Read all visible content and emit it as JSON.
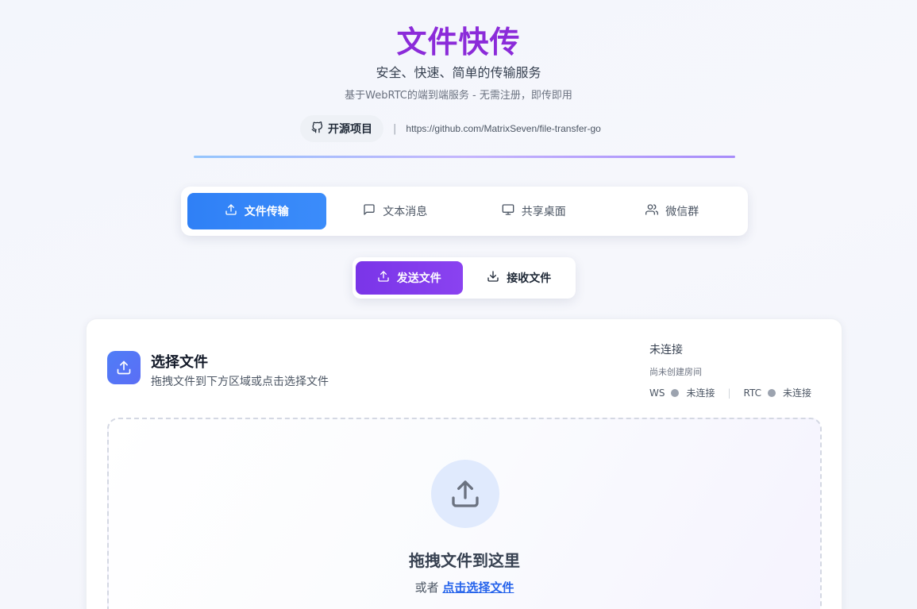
{
  "header": {
    "title": "文件快传",
    "subtitle": "安全、快速、简单的传输服务",
    "tagline": "基于WebRTC的端到端服务 - 无需注册，即传即用",
    "repo_label": "开源项目",
    "repo_separator": "|",
    "repo_url": "https://github.com/MatrixSeven/file-transfer-go"
  },
  "main_tabs": [
    {
      "label": "文件传输",
      "icon": "upload-icon",
      "active": true
    },
    {
      "label": "文本消息",
      "icon": "message-icon",
      "active": false
    },
    {
      "label": "共享桌面",
      "icon": "monitor-icon",
      "active": false
    },
    {
      "label": "微信群",
      "icon": "users-icon",
      "active": false
    }
  ],
  "sub_tabs": [
    {
      "label": "发送文件",
      "icon": "upload-icon",
      "active": true
    },
    {
      "label": "接收文件",
      "icon": "download-icon",
      "active": false
    }
  ],
  "card": {
    "icon": "upload-icon",
    "title": "选择文件",
    "description": "拖拽文件到下方区域或点击选择文件"
  },
  "connection": {
    "title": "未连接",
    "room_status": "尚未创建房间",
    "ws_label": "WS",
    "ws_status": "未连接",
    "separator": "|",
    "rtc_label": "RTC",
    "rtc_status": "未连接"
  },
  "drop_zone": {
    "icon": "upload-icon",
    "title": "拖拽文件到这里",
    "or_text": "或者",
    "link_text": "点击选择文件"
  },
  "colors": {
    "title": "#8b2bd9",
    "main_tab_active": "#2f80f6",
    "sub_tab_active": "#7c3aed",
    "status_dot": "#9ca3af",
    "link": "#2563eb"
  }
}
